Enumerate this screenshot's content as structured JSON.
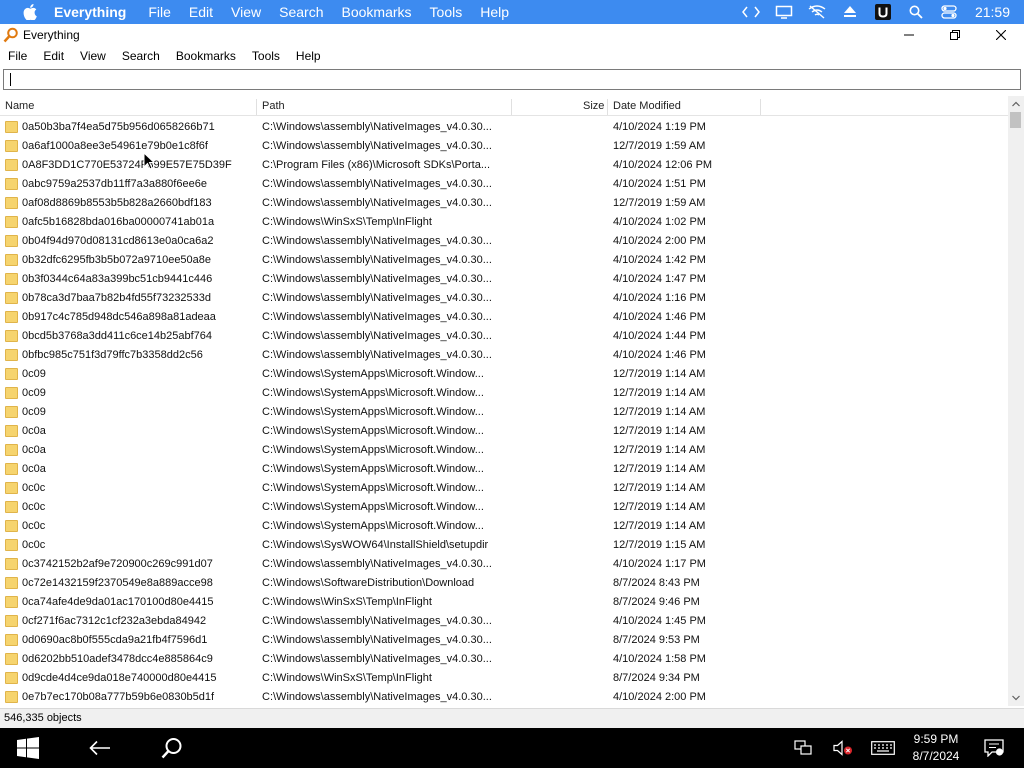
{
  "macbar": {
    "app_name": "Everything",
    "menu": [
      "File",
      "Edit",
      "View",
      "Search",
      "Bookmarks",
      "Tools",
      "Help"
    ],
    "clock": "21:59",
    "status_icons": [
      "code-icon",
      "display-icon",
      "wifi-off-icon",
      "eject-icon",
      "u-app-icon",
      "search-icon",
      "control-center-icon"
    ]
  },
  "window": {
    "title": "Everything",
    "menu": [
      "File",
      "Edit",
      "View",
      "Search",
      "Bookmarks",
      "Tools",
      "Help"
    ]
  },
  "search": {
    "value": "",
    "placeholder": ""
  },
  "columns": {
    "name": "Name",
    "path": "Path",
    "size": "Size",
    "date": "Date Modified"
  },
  "rows": [
    {
      "name": "0a50b3ba7f4ea5d75b956d0658266b71",
      "path": "C:\\Windows\\assembly\\NativeImages_v4.0.30...",
      "date": "4/10/2024 1:19 PM"
    },
    {
      "name": "0a6af1000a8ee3e54961e79b0e1c8f6f",
      "path": "C:\\Windows\\assembly\\NativeImages_v4.0.30...",
      "date": "12/7/2019 1:59 AM"
    },
    {
      "name": "0A8F3DD1C770E53724F899E57E75D39F",
      "path": "C:\\Program Files (x86)\\Microsoft SDKs\\Porta...",
      "date": "4/10/2024 12:06 PM"
    },
    {
      "name": "0abc9759a2537db11ff7a3a880f6ee6e",
      "path": "C:\\Windows\\assembly\\NativeImages_v4.0.30...",
      "date": "4/10/2024 1:51 PM"
    },
    {
      "name": "0af08d8869b8553b5b828a2660bdf183",
      "path": "C:\\Windows\\assembly\\NativeImages_v4.0.30...",
      "date": "12/7/2019 1:59 AM"
    },
    {
      "name": "0afc5b16828bda016ba00000741ab01a",
      "path": "C:\\Windows\\WinSxS\\Temp\\InFlight",
      "date": "4/10/2024 1:02 PM"
    },
    {
      "name": "0b04f94d970d08131cd8613e0a0ca6a2",
      "path": "C:\\Windows\\assembly\\NativeImages_v4.0.30...",
      "date": "4/10/2024 2:00 PM"
    },
    {
      "name": "0b32dfc6295fb3b5b072a9710ee50a8e",
      "path": "C:\\Windows\\assembly\\NativeImages_v4.0.30...",
      "date": "4/10/2024 1:42 PM"
    },
    {
      "name": "0b3f0344c64a83a399bc51cb9441c446",
      "path": "C:\\Windows\\assembly\\NativeImages_v4.0.30...",
      "date": "4/10/2024 1:47 PM"
    },
    {
      "name": "0b78ca3d7baa7b82b4fd55f73232533d",
      "path": "C:\\Windows\\assembly\\NativeImages_v4.0.30...",
      "date": "4/10/2024 1:16 PM"
    },
    {
      "name": "0b917c4c785d948dc546a898a81adeaa",
      "path": "C:\\Windows\\assembly\\NativeImages_v4.0.30...",
      "date": "4/10/2024 1:46 PM"
    },
    {
      "name": "0bcd5b3768a3dd411c6ce14b25abf764",
      "path": "C:\\Windows\\assembly\\NativeImages_v4.0.30...",
      "date": "4/10/2024 1:44 PM"
    },
    {
      "name": "0bfbc985c751f3d79ffc7b3358dd2c56",
      "path": "C:\\Windows\\assembly\\NativeImages_v4.0.30...",
      "date": "4/10/2024 1:46 PM"
    },
    {
      "name": "0c09",
      "path": "C:\\Windows\\SystemApps\\Microsoft.Window...",
      "date": "12/7/2019 1:14 AM"
    },
    {
      "name": "0c09",
      "path": "C:\\Windows\\SystemApps\\Microsoft.Window...",
      "date": "12/7/2019 1:14 AM"
    },
    {
      "name": "0c09",
      "path": "C:\\Windows\\SystemApps\\Microsoft.Window...",
      "date": "12/7/2019 1:14 AM"
    },
    {
      "name": "0c0a",
      "path": "C:\\Windows\\SystemApps\\Microsoft.Window...",
      "date": "12/7/2019 1:14 AM"
    },
    {
      "name": "0c0a",
      "path": "C:\\Windows\\SystemApps\\Microsoft.Window...",
      "date": "12/7/2019 1:14 AM"
    },
    {
      "name": "0c0a",
      "path": "C:\\Windows\\SystemApps\\Microsoft.Window...",
      "date": "12/7/2019 1:14 AM"
    },
    {
      "name": "0c0c",
      "path": "C:\\Windows\\SystemApps\\Microsoft.Window...",
      "date": "12/7/2019 1:14 AM"
    },
    {
      "name": "0c0c",
      "path": "C:\\Windows\\SystemApps\\Microsoft.Window...",
      "date": "12/7/2019 1:14 AM"
    },
    {
      "name": "0c0c",
      "path": "C:\\Windows\\SystemApps\\Microsoft.Window...",
      "date": "12/7/2019 1:14 AM"
    },
    {
      "name": "0c0c",
      "path": "C:\\Windows\\SysWOW64\\InstallShield\\setupdir",
      "date": "12/7/2019 1:15 AM"
    },
    {
      "name": "0c3742152b2af9e720900c269c991d07",
      "path": "C:\\Windows\\assembly\\NativeImages_v4.0.30...",
      "date": "4/10/2024 1:17 PM"
    },
    {
      "name": "0c72e1432159f2370549e8a889acce98",
      "path": "C:\\Windows\\SoftwareDistribution\\Download",
      "date": "8/7/2024 8:43 PM"
    },
    {
      "name": "0ca74afe4de9da01ac170100d80e4415",
      "path": "C:\\Windows\\WinSxS\\Temp\\InFlight",
      "date": "8/7/2024 9:46 PM"
    },
    {
      "name": "0cf271f6ac7312c1cf232a3ebda84942",
      "path": "C:\\Windows\\assembly\\NativeImages_v4.0.30...",
      "date": "4/10/2024 1:45 PM"
    },
    {
      "name": "0d0690ac8b0f555cda9a21fb4f7596d1",
      "path": "C:\\Windows\\assembly\\NativeImages_v4.0.30...",
      "date": "8/7/2024 9:53 PM"
    },
    {
      "name": "0d6202bb510adef3478dcc4e885864c9",
      "path": "C:\\Windows\\assembly\\NativeImages_v4.0.30...",
      "date": "4/10/2024 1:58 PM"
    },
    {
      "name": "0d9cde4d4ce9da018e740000d80e4415",
      "path": "C:\\Windows\\WinSxS\\Temp\\InFlight",
      "date": "8/7/2024 9:34 PM"
    },
    {
      "name": "0e7b7ec170b08a777b59b6e0830b5d1f",
      "path": "C:\\Windows\\assembly\\NativeImages_v4.0.30...",
      "date": "4/10/2024 2:00 PM"
    }
  ],
  "status": {
    "objects": "546,335 objects"
  },
  "taskbar": {
    "time": "9:59 PM",
    "date": "8/7/2024"
  },
  "colors": {
    "mac_bar": "#3d8bf0",
    "folder": "#f6d46e",
    "taskbar": "#000000"
  }
}
